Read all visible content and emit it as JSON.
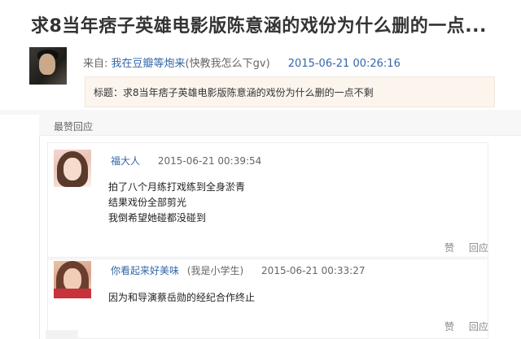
{
  "post": {
    "title": "求8当年痞子英雄电影版陈意涵的戏份为什么删的一点...",
    "from_label": "来自:",
    "author_link": "我在豆瓣等炮来",
    "author_note": "(快教我怎么下gv)",
    "time": "2015-06-21 00:26:16",
    "quote_text": "标题：求8当年痞子英雄电影版陈意涵的戏份为什么删的一点不剩"
  },
  "replies_header": "最赞回应",
  "comments": [
    {
      "user": "福大人",
      "tag": "",
      "time": "2015-06-21 00:39:54",
      "lines": [
        "拍了八个月练打戏练到全身淤青",
        "结果戏份全部剪光",
        "我倒希望她碰都没碰到"
      ],
      "like_label": "赞",
      "reply_label": "回应"
    },
    {
      "user": "你看起来好美味",
      "tag": "(我是小学生)",
      "time": "2015-06-21 00:33:27",
      "lines": [
        "因为和导演蔡岳勋的经纪合作终止"
      ],
      "like_label": "赞",
      "reply_label": "回应"
    }
  ]
}
